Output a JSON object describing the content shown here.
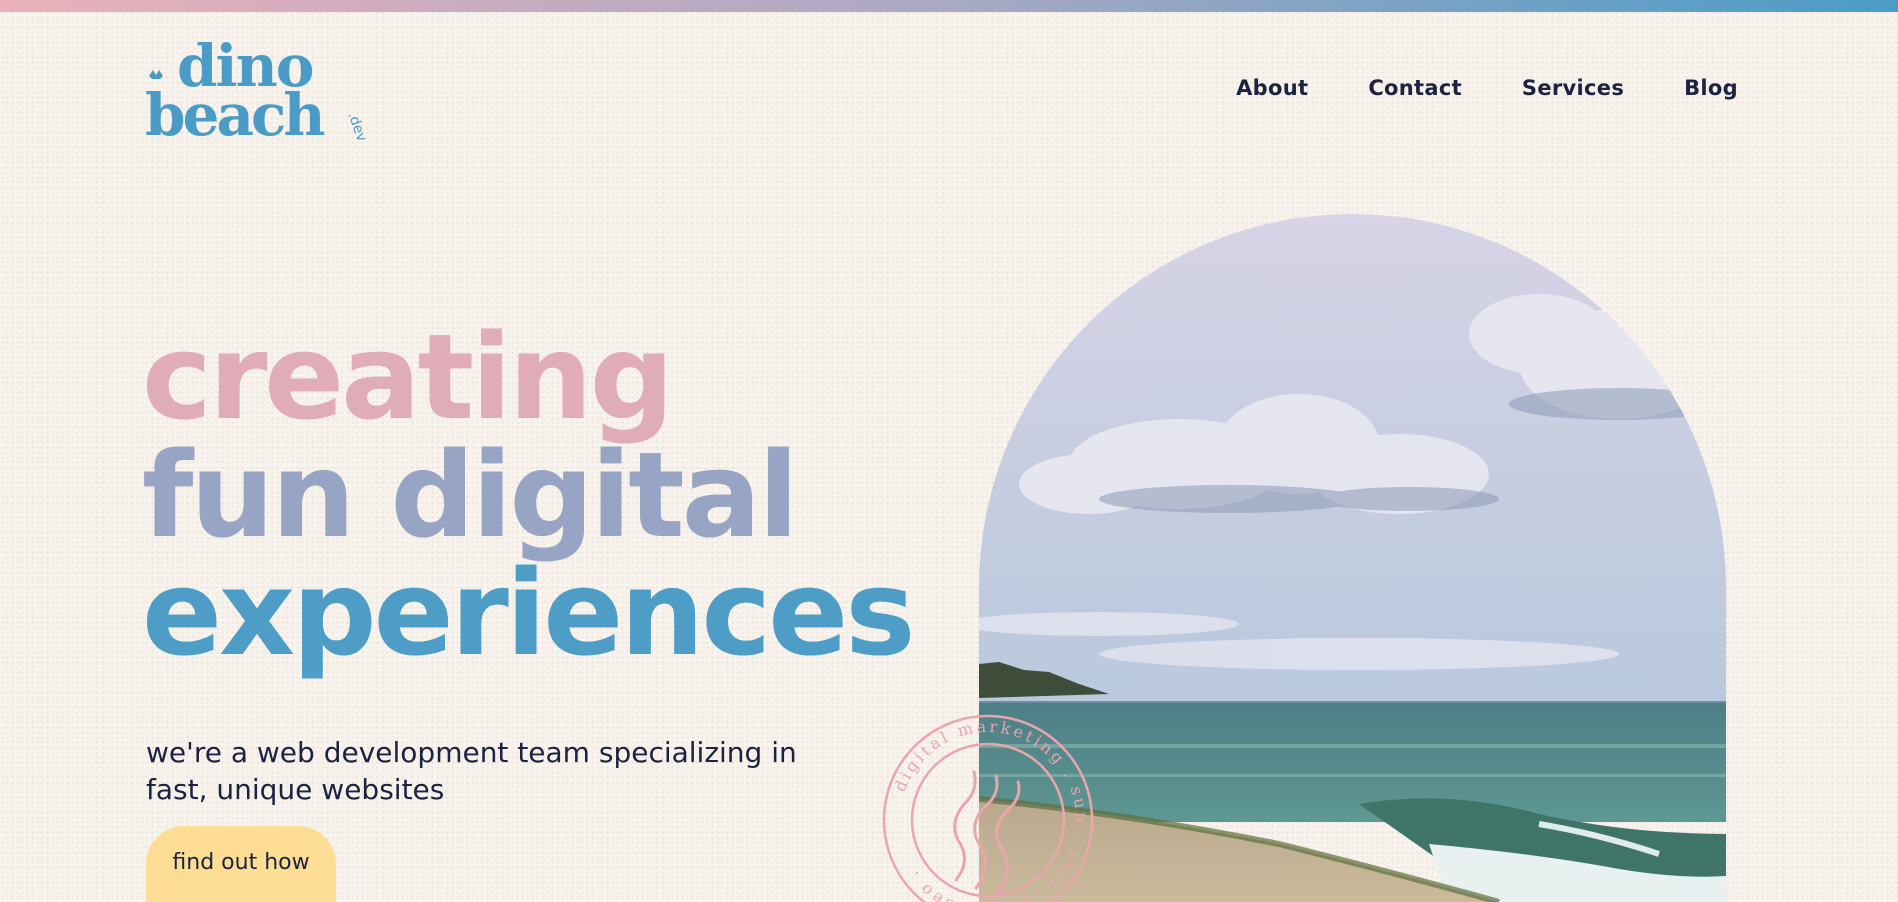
{
  "brand": {
    "logo_word1": "dino",
    "logo_word2": "beach",
    "logo_suffix": ".dev"
  },
  "nav": {
    "items": [
      "About",
      "Contact",
      "Services",
      "Blog"
    ]
  },
  "hero": {
    "headline_lines": [
      "creating",
      "fun digital",
      "experiences"
    ],
    "subtext": "we're a web development team specializing in fast, unique websites",
    "cta_label": "find out how"
  },
  "stamp": {
    "ring_text": "digital marketing . sun . surf . sand . seo ."
  },
  "colors": {
    "top_gradient_start": "#eab0bb",
    "top_gradient_end": "#4a9cc6",
    "pink": "#e0acba",
    "blue": "#4e9dc6",
    "text_dark": "#1b2340",
    "cta_bg": "#fddc94",
    "background": "#f8f3ec"
  },
  "images": {
    "hero_photo": "beach-seascape-photo",
    "stamp_icon": "waves-icon"
  }
}
